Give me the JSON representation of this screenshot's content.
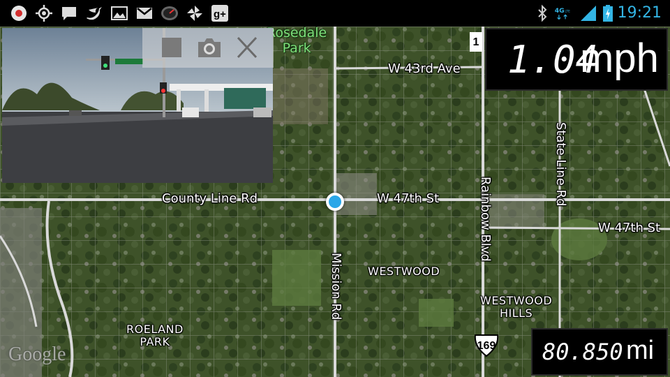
{
  "status_bar": {
    "left_icons": [
      "record-icon",
      "gps-icon",
      "message-icon",
      "twitter-icon",
      "gallery-icon",
      "gmail-icon",
      "speedometer-icon",
      "pinwheel-icon",
      "google-plus-icon"
    ],
    "right_icons": [
      "bluetooth-icon",
      "4g-lte-icon",
      "signal-icon",
      "battery-charging-icon"
    ],
    "network_label": "4G",
    "time": "19:21"
  },
  "speed": {
    "value": "1.04",
    "unit": "mph"
  },
  "distance": {
    "value": "80.850",
    "unit": "mi"
  },
  "camera_preview": {
    "controls": [
      "stop-icon",
      "camera-icon",
      "close-icon"
    ]
  },
  "map": {
    "roads": {
      "county_line": "County Line Rd",
      "w47_left": "W 47th St",
      "w47_right": "W 47th St",
      "w43": "W 43rd Ave",
      "mission": "Mission Rd",
      "rainbow": "Rainbow Blvd",
      "state_line": "State Line Rd"
    },
    "areas": {
      "westwood": "WESTWOOD",
      "westwood_hills_1": "WESTWOOD",
      "westwood_hills_2": "HILLS",
      "roeland_1": "ROELAND",
      "roeland_2": "PARK",
      "rosedale_1": "Rosedale",
      "rosedale_2": "Park"
    },
    "shields": {
      "us169": "169",
      "top": "1"
    },
    "attribution": "Google"
  },
  "colors": {
    "accent": "#33b5e5",
    "location": "#2aa6e8",
    "park_text": "#7fe07a"
  }
}
